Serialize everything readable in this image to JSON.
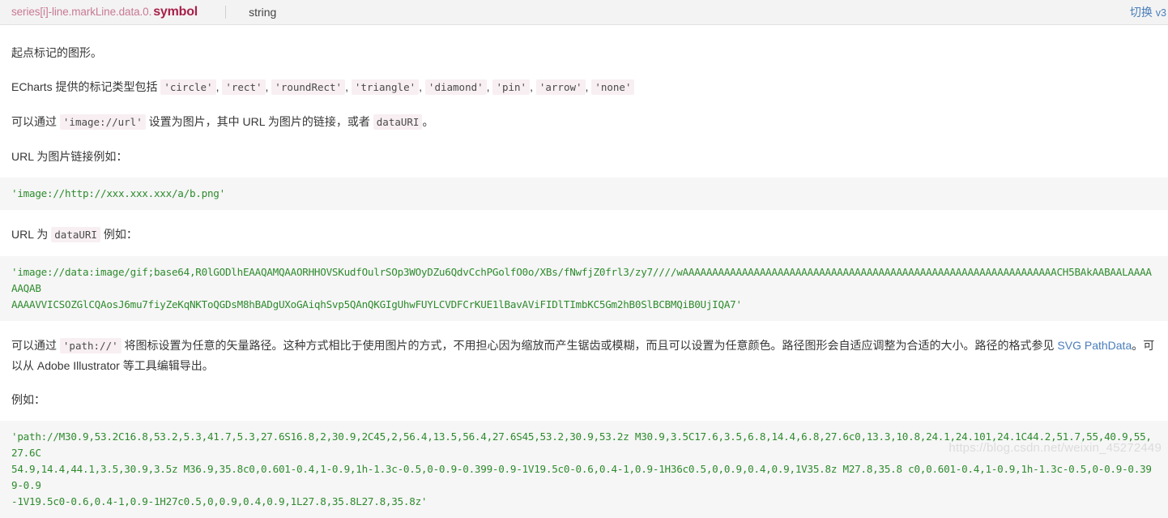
{
  "header": {
    "breadcrumb_path": "series[i]-line.markLine.data.0.",
    "breadcrumb_leaf": "symbol",
    "type_label": "string",
    "version_switch_label": "切换",
    "version_switch_value": "v3"
  },
  "content": {
    "intro": "起点标记的图形。",
    "marker_types_prefix": "ECharts 提供的标记类型包括",
    "marker_types": [
      "'circle'",
      "'rect'",
      "'roundRect'",
      "'triangle'",
      "'diamond'",
      "'pin'",
      "'arrow'",
      "'none'"
    ],
    "image_url_line": {
      "p1": "可以通过",
      "code1": "'image://url'",
      "p2": "设置为图片，其中 URL 为图片的链接，或者",
      "code2": "dataURI",
      "p3": "。"
    },
    "url_example_heading": "URL 为图片链接例如：",
    "url_example_code": "'image://http://xxx.xxx.xxx/a/b.png'",
    "datauri_heading": {
      "p1": "URL 为",
      "code1": "dataURI",
      "p2": "例如："
    },
    "datauri_code": "'image://data:image/gif;base64,R0lGODlhEAAQAMQAAORHHOVSKudfOulrSOp3WOyDZu6QdvCchPGolfO0o/XBs/fNwfjZ0frl3/zy7////wAAAAAAAAAAAAAAAAAAAAAAAAAAAAAAAAAAAAAAAAAAAAAAAAAAAAAAAAAAAAAAACH5BAkAABAALAAAAAAQAB\nAAAAVVICSOZGlCQAosJ6mu7fiyZeKqNKToQGDsM8hBADgUXoGAiqhSvp5QAnQKGIgUhwFUYLCVDFCrKUE1lBavAViFIDlTImbKC5Gm2hB0SlBCBMQiB0UjIQA7'",
    "path_paragraph": {
      "p1": "可以通过",
      "code1": "'path://'",
      "p2": "将图标设置为任意的矢量路径。这种方式相比于使用图片的方式，不用担心因为缩放而产生锯齿或模糊，而且可以设置为任意颜色。路径图形会自适应调整为合适的大小。路径的格式参见",
      "link": "SVG PathData",
      "p3": "。可以从 Adobe Illustrator 等工具编辑导出。"
    },
    "example_heading": "例如：",
    "path_code": "'path://M30.9,53.2C16.8,53.2,5.3,41.7,5.3,27.6S16.8,2,30.9,2C45,2,56.4,13.5,56.4,27.6S45,53.2,30.9,53.2z M30.9,3.5C17.6,3.5,6.8,14.4,6.8,27.6c0,13.3,10.8,24.1,24.101,24.1C44.2,51.7,55,40.9,55,27.6C\n54.9,14.4,44.1,3.5,30.9,3.5z M36.9,35.8c0,0.601-0.4,1-0.9,1h-1.3c-0.5,0-0.9-0.399-0.9-1V19.5c0-0.6,0.4-1,0.9-1H36c0.5,0,0.9,0.4,0.9,1V35.8z M27.8,35.8 c0,0.601-0.4,1-0.9,1h-1.3c-0.5,0-0.9-0.399-0.9\n-1V19.5c0-0.6,0.4-1,0.9-1H27c0.5,0,0.9,0.4,0.9,1L27.8,35.8L27.8,35.8z'"
  },
  "watermark": "https://blog.csdn.net/weixin_45272449"
}
